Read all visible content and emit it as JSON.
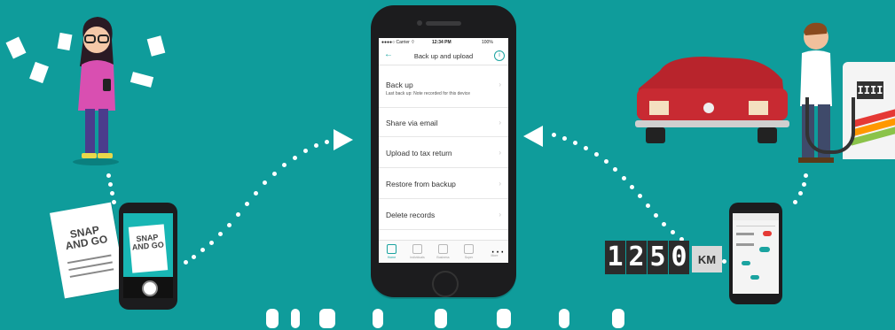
{
  "status_bar": {
    "carrier": "●●●●○ Carrier ⌔",
    "time": "12:34 PM",
    "battery": "100%"
  },
  "nav": {
    "title": "Back up and upload",
    "back_icon": "back-arrow-icon",
    "info_icon": "info-icon"
  },
  "menu": [
    {
      "label": "Back up",
      "sub": "Last back up: Note recorded for this device"
    },
    {
      "label": "Share via email"
    },
    {
      "label": "Upload to tax return"
    },
    {
      "label": "Restore from backup"
    },
    {
      "label": "Delete records"
    }
  ],
  "tabs": [
    "Home",
    "Individuals",
    "Business",
    "Super",
    "More"
  ],
  "receipt": {
    "line1": "SNAP",
    "line2": "AND GO"
  },
  "odometer": {
    "digits": [
      "1",
      "2",
      "5",
      "0"
    ],
    "unit": "KM"
  },
  "pump": {
    "display": "IIII"
  }
}
